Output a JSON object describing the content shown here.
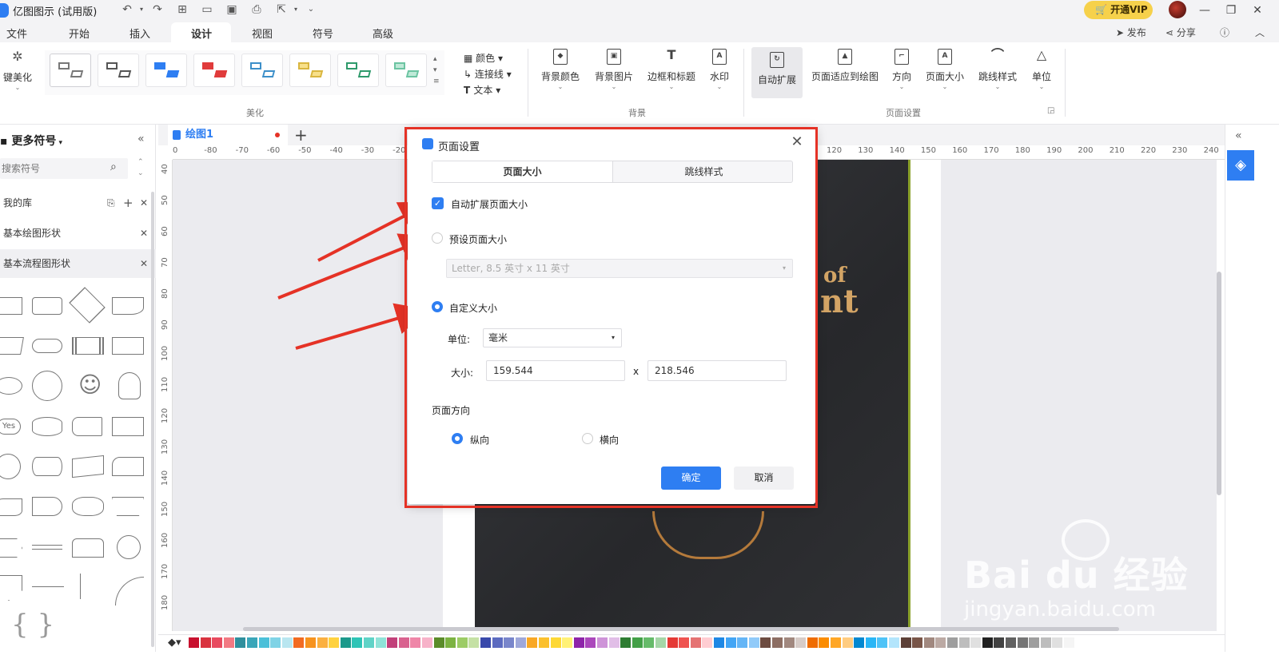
{
  "app": {
    "title": "亿图图示 (试用版)"
  },
  "titlebar": {
    "vip_label": "开通VIP"
  },
  "menubar": {
    "items": [
      "文件",
      "开始",
      "插入",
      "设计",
      "视图",
      "符号",
      "高级"
    ],
    "active": "设计",
    "publish": "发布",
    "share": "分享"
  },
  "ribbon": {
    "beautify_button": "键美化",
    "beautify_group": "美化",
    "color_item": "颜色",
    "connector_item": "连接线",
    "text_item": "文本",
    "background_group": "背景",
    "background_buttons": [
      "背景颜色",
      "背景图片",
      "边框和标题",
      "水印"
    ],
    "page_group": "页面设置",
    "page_buttons": [
      "自动扩展",
      "页面适应到绘图",
      "方向",
      "页面大小",
      "跳线样式",
      "单位"
    ]
  },
  "leftpanel": {
    "title": "更多符号",
    "search_placeholder": "搜索符号",
    "libraries": [
      "我的库",
      "基本绘图形状",
      "基本流程图形状"
    ],
    "yes_label": "Yes"
  },
  "document": {
    "tab_label": "绘图1"
  },
  "rulers": {
    "h_ticks": [
      "0",
      "-80",
      "-70",
      "-60",
      "-50",
      "-40",
      "-30",
      "-20",
      "120",
      "130",
      "140",
      "150",
      "160",
      "170",
      "180",
      "190",
      "200",
      "210",
      "220",
      "230",
      "240"
    ],
    "v_ticks": [
      "40",
      "50",
      "60",
      "70",
      "80",
      "90",
      "100",
      "110",
      "120",
      "130",
      "140",
      "150",
      "160",
      "170",
      "180"
    ]
  },
  "canvas": {
    "photo_text_line1": "of",
    "photo_text_line2": "nt"
  },
  "dialog": {
    "title": "页面设置",
    "tabs": [
      "页面大小",
      "跳线样式"
    ],
    "active_tab": "页面大小",
    "auto_expand_label": "自动扩展页面大小",
    "auto_expand_checked": true,
    "preset_label": "预设页面大小",
    "preset_value": "Letter, 8.5 英寸 x 11 英寸",
    "custom_label": "自定义大小",
    "custom_selected": true,
    "unit_label": "单位:",
    "unit_value": "毫米",
    "size_label": "大小:",
    "width": "159.544",
    "times": "x",
    "height": "218.546",
    "orientation_label": "页面方向",
    "portrait": "纵向",
    "landscape": "横向",
    "orientation_selected": "纵向",
    "ok": "确定",
    "cancel": "取消"
  },
  "watermark": {
    "brand": "Bai du 经验",
    "url": "jingyan.baidu.com"
  },
  "palette": [
    "#c8102e",
    "#d9333f",
    "#e84a5f",
    "#f27983",
    "#2f8f9d",
    "#3aa6b9",
    "#4bc0d9",
    "#7fd3e6",
    "#b9e6f0",
    "#f26b21",
    "#f7931e",
    "#fbb040",
    "#ffd23f",
    "#1b998b",
    "#2ec4b6",
    "#5fd3c7",
    "#8fe3d8",
    "#c2407a",
    "#d9628f",
    "#ef86a8",
    "#f7b2c9",
    "#5b8c2a",
    "#7cb342",
    "#9ccc65",
    "#c5e1a5",
    "#3949ab",
    "#5c6bc0",
    "#7986cb",
    "#9fa8da",
    "#f9a825",
    "#fbc02d",
    "#fdd835",
    "#fff176",
    "#8e24aa",
    "#ab47bc",
    "#ce93d8",
    "#e1bee7",
    "#2e7d32",
    "#43a047",
    "#66bb6a",
    "#a5d6a7",
    "#e53935",
    "#ef5350",
    "#e57373",
    "#ffcdd2",
    "#1e88e5",
    "#42a5f5",
    "#64b5f6",
    "#90caf9",
    "#6d4c41",
    "#8d6e63",
    "#a1887f",
    "#d7ccc8",
    "#ef6c00",
    "#fb8c00",
    "#ffa726",
    "#ffcc80",
    "#0288d1",
    "#29b6f6",
    "#4fc3f7",
    "#b3e5fc",
    "#5d4037",
    "#795548",
    "#a1887f",
    "#bcaaa4",
    "#9e9e9e",
    "#bdbdbd",
    "#e0e0e0",
    "#212121",
    "#424242",
    "#616161",
    "#757575",
    "#9e9e9e",
    "#bdbdbd",
    "#e0e0e0",
    "#f5f5f5"
  ]
}
